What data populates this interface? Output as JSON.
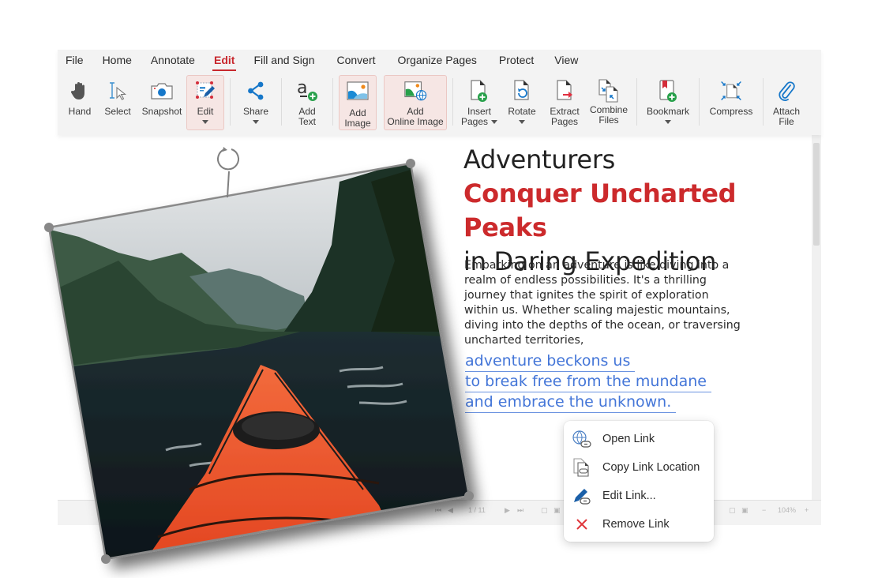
{
  "menu": {
    "items": [
      {
        "label": "File",
        "active": false
      },
      {
        "label": "Home",
        "active": false
      },
      {
        "label": "Annotate",
        "active": false
      },
      {
        "label": "Edit",
        "active": true
      },
      {
        "label": "Fill and Sign",
        "active": false
      },
      {
        "label": "Convert",
        "active": false
      },
      {
        "label": "Organize Pages",
        "active": false
      },
      {
        "label": "Protect",
        "active": false
      },
      {
        "label": "View",
        "active": false
      }
    ]
  },
  "toolbar": {
    "hand": {
      "label": "Hand",
      "icon": "hand-icon"
    },
    "select": {
      "label": "Select",
      "icon": "text-select-icon"
    },
    "snapshot": {
      "label": "Snapshot",
      "icon": "camera-icon"
    },
    "edit": {
      "label": "Edit",
      "icon": "edit-object-icon",
      "selected": true
    },
    "share": {
      "label": "Share",
      "icon": "share-icon"
    },
    "add_text": {
      "label_line1": "Add",
      "label_line2": "Text",
      "icon": "add-text-icon"
    },
    "add_image": {
      "label_line1": "Add",
      "label_line2": "Image",
      "icon": "image-icon",
      "selected": true
    },
    "add_online_image": {
      "label_line1": "Add",
      "label_line2": "Online Image",
      "icon": "online-image-icon",
      "selected": true
    },
    "insert_pages": {
      "label_line1": "Insert",
      "label_line2": "Pages",
      "icon": "insert-page-icon"
    },
    "rotate": {
      "label": "Rotate",
      "icon": "rotate-page-icon"
    },
    "extract_pages": {
      "label_line1": "Extract",
      "label_line2": "Pages",
      "icon": "extract-page-icon"
    },
    "combine_files": {
      "label_line1": "Combine",
      "label_line2": "Files",
      "icon": "combine-files-icon"
    },
    "bookmark": {
      "label": "Bookmark",
      "icon": "bookmark-icon"
    },
    "compress": {
      "label": "Compress",
      "icon": "compress-icon"
    },
    "attach_file": {
      "label_line1": "Attach",
      "label_line2": "File",
      "icon": "paperclip-icon"
    }
  },
  "document": {
    "headline_line1": "Adventurers",
    "headline_line2": "Conquer Uncharted Peaks",
    "headline_line3": "in Daring Expedition",
    "body": "Embarking on an adventure is like diving into a realm of endless possibilities. It's a thrilling journey that ignites the spirit of exploration within us. Whether scaling majestic mountains, diving into the depths of the ocean, or traversing uncharted territories,",
    "link_lines": [
      "adventure beckons us",
      "to break free from the mundane",
      "and embrace the unknown."
    ],
    "image_alt": "Kayak bow on a fjord between steep green mountains"
  },
  "statusbar": {
    "page": "1 / 11",
    "zoom": "104%"
  },
  "context_menu": {
    "items": [
      {
        "label": "Open Link",
        "icon": "globe-link-icon"
      },
      {
        "label": "Copy Link Location",
        "icon": "copy-link-icon"
      },
      {
        "label": "Edit Link...",
        "icon": "edit-link-icon"
      },
      {
        "label": "Remove Link",
        "icon": "remove-icon"
      }
    ]
  },
  "colors": {
    "accent": "#c8282e",
    "headline_red": "#cc2a2c",
    "link_blue": "#4476d8",
    "icon_blue": "#1677c9",
    "icon_green": "#27a04a"
  }
}
